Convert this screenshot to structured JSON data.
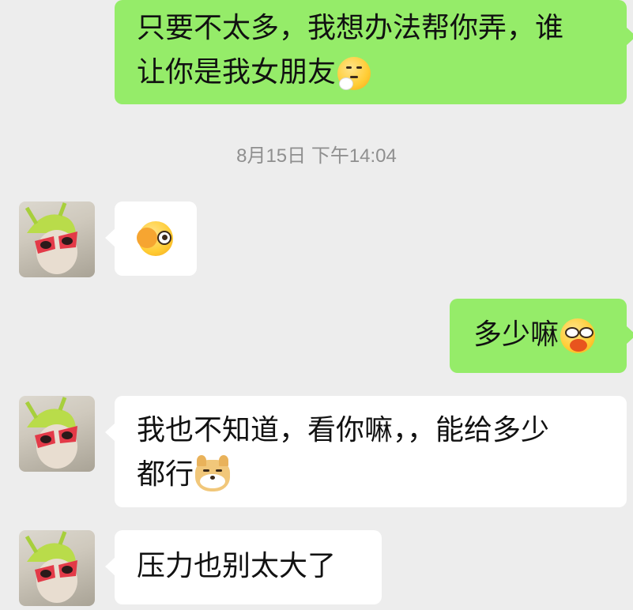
{
  "messages": [
    {
      "direction": "outgoing",
      "lines": [
        "只要不太多，我想办法帮你弄，谁",
        "让你是我女朋友"
      ],
      "emoji": "thinking-face-icon"
    },
    {
      "type": "timestamp",
      "text": "8月15日 下午14:04"
    },
    {
      "direction": "incoming",
      "lines": [],
      "emoji": "ok-hand-eye-icon"
    },
    {
      "direction": "outgoing",
      "lines": [
        "多少嘛"
      ],
      "emoji": "eating-face-icon"
    },
    {
      "direction": "incoming",
      "lines": [
        "我也不知道，看你嘛，，能给多少",
        "都行"
      ],
      "emoji": "doge-icon"
    },
    {
      "direction": "incoming",
      "lines": [
        "压力也别太大了"
      ],
      "emoji": ""
    }
  ],
  "colors": {
    "background": "#ededed",
    "outgoing_bubble": "#95ec69",
    "incoming_bubble": "#ffffff",
    "timestamp_text": "#8f8f8f"
  }
}
